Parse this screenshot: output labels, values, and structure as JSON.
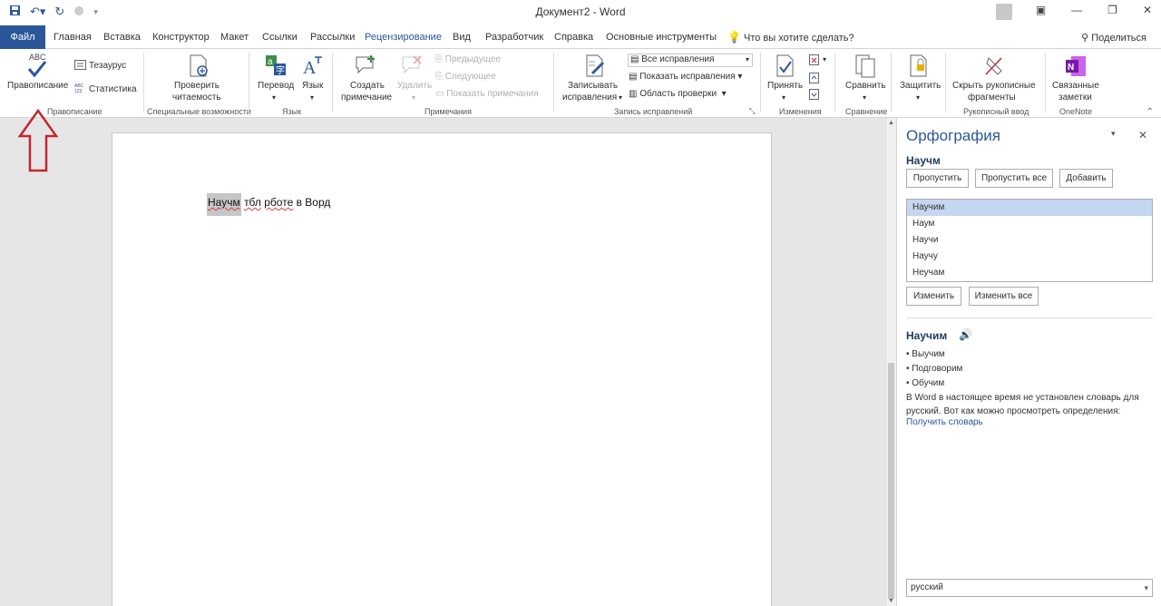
{
  "title_bar": {
    "document_title": "Документ2 - Word",
    "quick_access": [
      "save-icon",
      "undo-icon",
      "redo-icon",
      "touch-mode-icon"
    ],
    "controls": [
      "ribbon-options-icon",
      "minimize-icon",
      "restore-icon",
      "close-icon"
    ]
  },
  "tabs": {
    "file": "Файл",
    "items": [
      "Главная",
      "Вставка",
      "Конструктор",
      "Макет",
      "Ссылки",
      "Рассылки",
      "Рецензирование",
      "Вид",
      "Разработчик",
      "Справка",
      "Основные инструменты"
    ],
    "active": "Рецензирование",
    "tell_me": "Что вы хотите сделать?",
    "share": "Поделиться"
  },
  "ribbon": {
    "proofing": {
      "abc": "ABC",
      "spelling": "Правописание",
      "thesaurus": "Тезаурус",
      "stats": "Статистика",
      "group": "Правописание"
    },
    "accessibility": {
      "check_line1": "Проверить",
      "check_line2": "читаемость",
      "group": "Специальные возможности"
    },
    "language": {
      "translate": "Перевод",
      "language": "Язык",
      "group": "Язык"
    },
    "comments": {
      "new_line1": "Создать",
      "new_line2": "примечание",
      "delete": "Удалить",
      "previous": "Предыдущее",
      "next": "Следующее",
      "show": "Показать примечания",
      "group": "Примечания"
    },
    "tracking": {
      "track_line1": "Записывать",
      "track_line2": "исправления",
      "all_markup": "Все исправления",
      "show_markup": "Показать исправления",
      "reviewing_pane": "Область проверки",
      "group": "Запись исправлений"
    },
    "changes": {
      "accept": "Принять",
      "group": "Изменения"
    },
    "compare": {
      "compare": "Сравнить",
      "group": "Сравнение"
    },
    "protect": {
      "protect": "Защитить"
    },
    "ink": {
      "hide_line1": "Скрыть рукописные",
      "hide_line2": "фрагменты",
      "group": "Рукописный ввод"
    },
    "onenote": {
      "linked_line1": "Связанные",
      "linked_line2": "заметки",
      "group": "OneNote"
    }
  },
  "document": {
    "misspelled": "Научм",
    "rest_1": " ",
    "word2": "тбл",
    "rest_2": " ",
    "word3": "рботе",
    "rest_3": " в Ворд"
  },
  "spelling_pane": {
    "title": "Орфография",
    "word": "Научм",
    "ignore": "Пропустить",
    "ignore_all": "Пропустить все",
    "add": "Добавить",
    "suggestions": [
      "Научим",
      "Наум",
      "Научи",
      "Научу",
      "Неучам"
    ],
    "selected_index": 0,
    "change": "Изменить",
    "change_all": "Изменить все",
    "definition_word": "Научим",
    "synonyms": [
      "• Выучим",
      "• Подговорим",
      "• Обучим"
    ],
    "note": "В Word в настоящее время не установлен словарь для русский. Вот как можно просмотреть определения:",
    "get_dictionary": "Получить словарь",
    "language": "русский"
  },
  "colors": {
    "accent": "#2b579a",
    "arrow": "#c0282d",
    "selection": "#c5d6f0"
  }
}
